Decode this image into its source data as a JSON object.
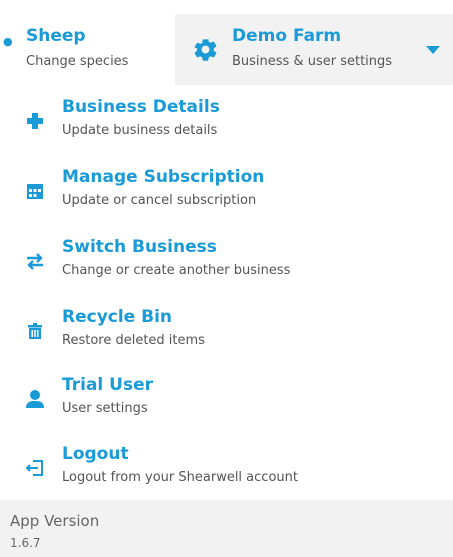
{
  "header": {
    "species": {
      "title": "Sheep",
      "subtitle": "Change species"
    },
    "business": {
      "title": "Demo Farm",
      "subtitle": "Business & user settings"
    }
  },
  "menu": [
    {
      "label": "Business Details",
      "description": "Update business details",
      "icon": "plus-icon"
    },
    {
      "label": "Manage Subscription",
      "description": "Update or cancel subscription",
      "icon": "calendar-icon"
    },
    {
      "label": "Switch Business",
      "description": "Change or create another business",
      "icon": "swap-icon"
    },
    {
      "label": "Recycle Bin",
      "description": "Restore deleted items",
      "icon": "trash-icon"
    },
    {
      "label": "Trial User",
      "description": "User settings",
      "icon": "user-icon"
    },
    {
      "label": "Logout",
      "description": "Logout from your Shearwell account",
      "icon": "logout-icon"
    }
  ],
  "footer": {
    "label": "App Version",
    "version": "1.6.7"
  },
  "colors": {
    "accent": "#1a9bd7",
    "muted_bg": "#f2f2f2"
  }
}
